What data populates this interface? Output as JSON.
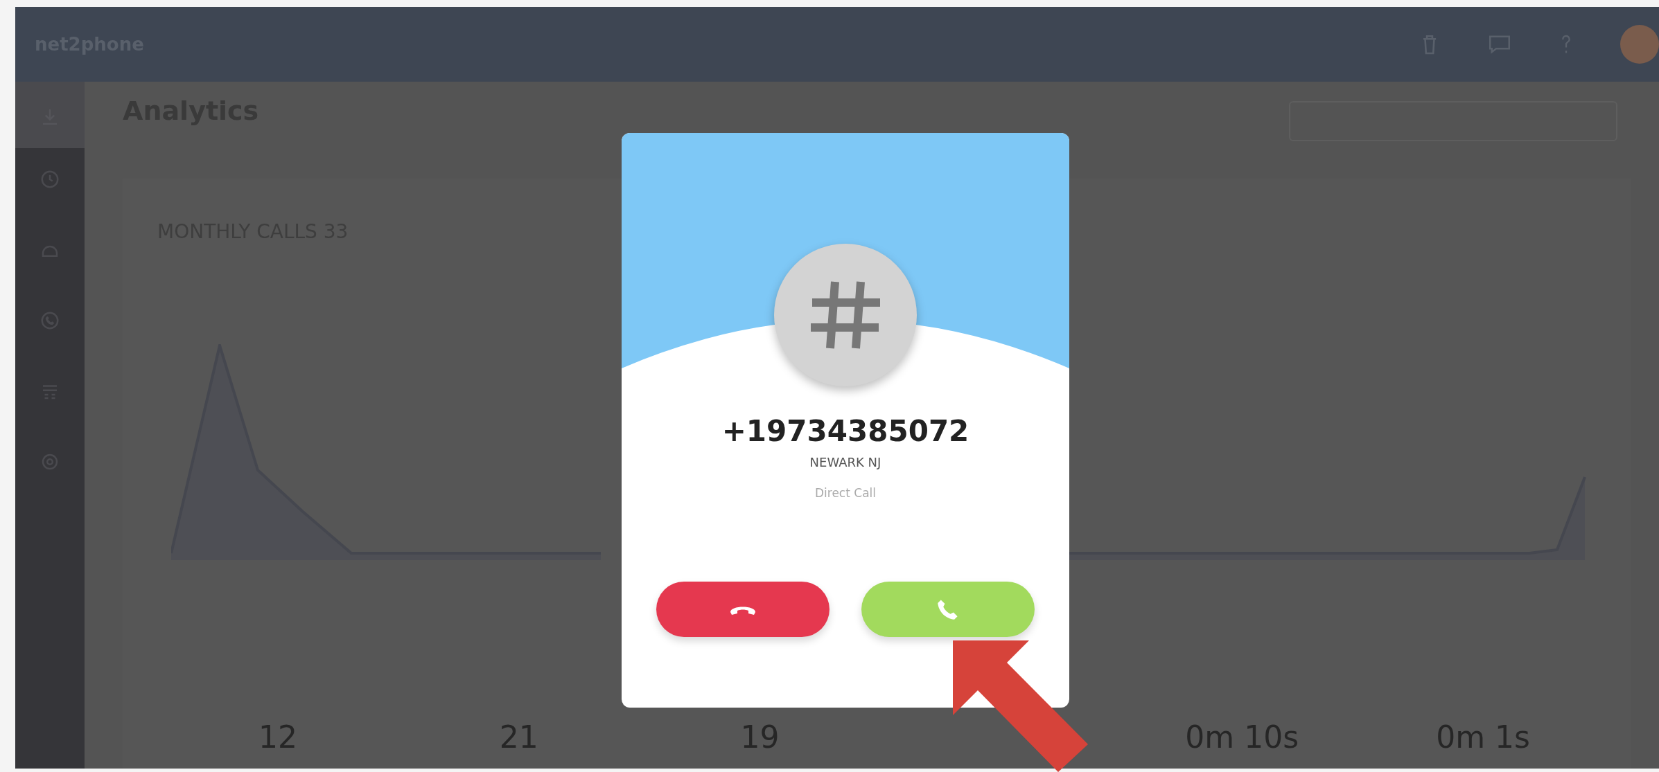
{
  "top_bar": {
    "logo": "net2phone"
  },
  "page": {
    "title": "Analytics"
  },
  "card": {
    "title": "MONTHLY CALLS 33"
  },
  "stats": [
    {
      "value": "12"
    },
    {
      "value": "21"
    },
    {
      "value": "19"
    },
    {
      "value": "0m 10s"
    },
    {
      "value": "0m 1s"
    }
  ],
  "incoming_call": {
    "number": "+19734385072",
    "location": "NEWARK NJ",
    "call_type": "Direct Call"
  }
}
